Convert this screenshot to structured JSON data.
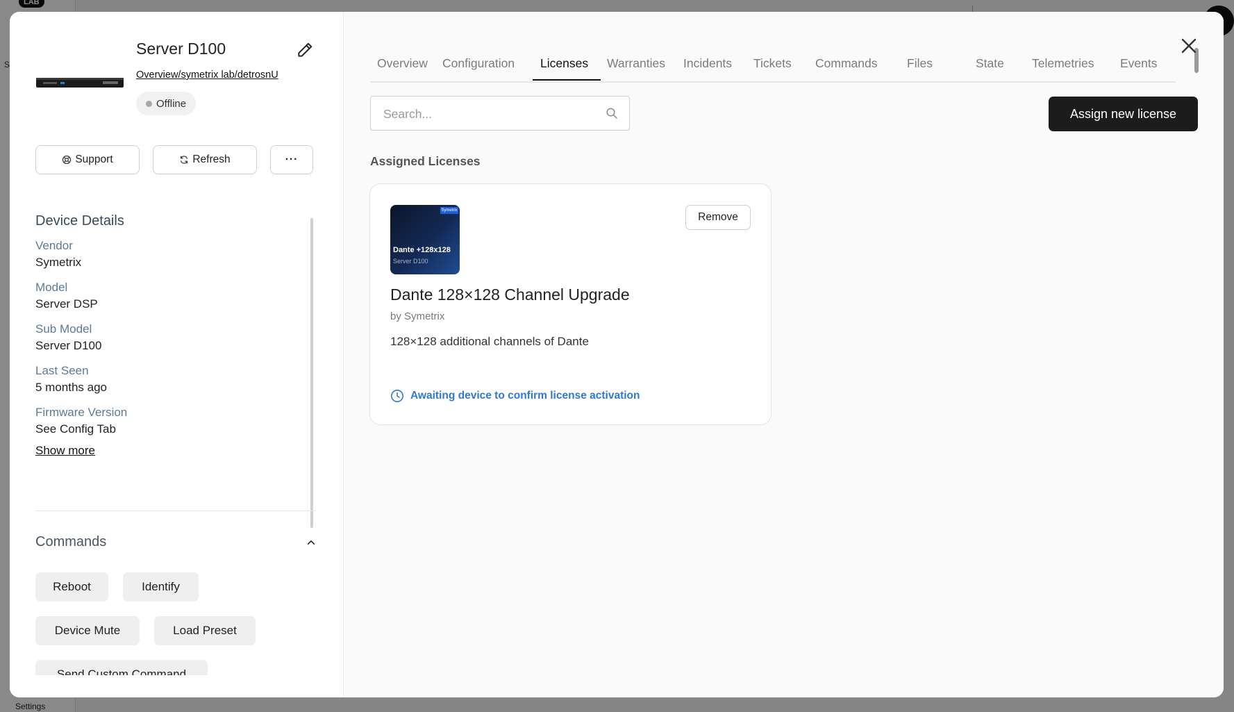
{
  "backdrop": {
    "badge": "LAB",
    "settings_label": "Settings",
    "s_label": "S"
  },
  "device": {
    "title": "Server D100",
    "breadcrumb": "Overview/symetrix lab/detrosnU",
    "status": "Offline"
  },
  "actions": {
    "support": "Support",
    "refresh": "Refresh",
    "more": "···"
  },
  "details": {
    "title": "Device Details",
    "fields": [
      {
        "label": "Vendor",
        "value": "Symetrix"
      },
      {
        "label": "Model",
        "value": "Server DSP"
      },
      {
        "label": "Sub Model",
        "value": "Server D100"
      },
      {
        "label": "Last Seen",
        "value": "5 months ago"
      },
      {
        "label": "Firmware Version",
        "value": "See Config Tab"
      }
    ],
    "show_more": "Show more"
  },
  "commands": {
    "title": "Commands",
    "items": [
      "Reboot",
      "Identify",
      "Device Mute",
      "Load Preset",
      "Send Custom Command"
    ]
  },
  "tabs": [
    {
      "label": "Overview"
    },
    {
      "label": "Configuration"
    },
    {
      "label": "Licenses",
      "active": true
    },
    {
      "label": "Warranties"
    },
    {
      "label": "Incidents"
    },
    {
      "label": "Tickets"
    },
    {
      "label": "Commands"
    },
    {
      "label": "Files"
    },
    {
      "label": "State"
    },
    {
      "label": "Telemetries"
    },
    {
      "label": "Events"
    }
  ],
  "search": {
    "placeholder": "Search...",
    "value": ""
  },
  "assign_button": "Assign new license",
  "assigned_title": "Assigned Licenses",
  "license": {
    "thumb_logo": "Symetrix",
    "thumb_title": "Dante +128x128",
    "thumb_subtitle": "Server D100",
    "remove": "Remove",
    "name": "Dante 128×128 Channel Upgrade",
    "vendor": "by Symetrix",
    "description": "128×128 additional channels of Dante",
    "status": "Awaiting device to confirm license activation"
  },
  "colors": {
    "primary_button": "#1c1c1c",
    "status_link": "#2f78d6",
    "field_label": "#5c7a93"
  }
}
